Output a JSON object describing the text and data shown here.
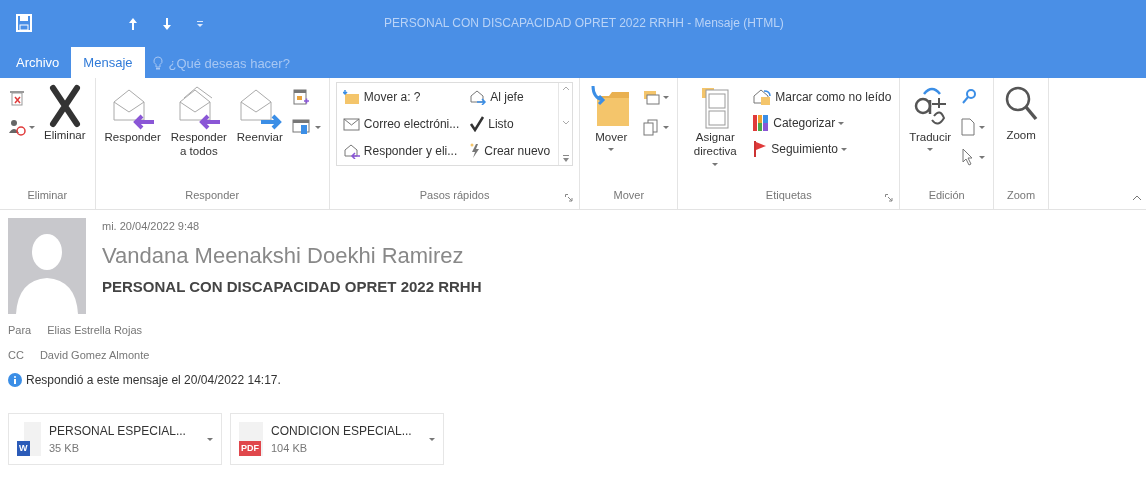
{
  "window": {
    "title": "PERSONAL CON DISCAPACIDAD OPRET 2022 RRHH - Mensaje (HTML)"
  },
  "tabs": [
    {
      "label": "Archivo",
      "selected": false
    },
    {
      "label": "Mensaje",
      "selected": true
    }
  ],
  "tell_me": {
    "placeholder": "¿Qué deseas hacer?"
  },
  "ribbon": {
    "groups": [
      {
        "label": "Eliminar",
        "items": [
          {
            "kind": "smallicons",
            "count_carets": [
              false,
              true
            ]
          },
          {
            "kind": "large",
            "label": "Eliminar",
            "caret": false
          }
        ]
      },
      {
        "label": "Responder",
        "items": [
          {
            "kind": "large",
            "label": "Responder",
            "caret": false
          },
          {
            "kind": "large",
            "label": "Responder a todos",
            "caret": false
          },
          {
            "kind": "large",
            "label": "Reenviar",
            "caret": false
          },
          {
            "kind": "smallicons",
            "count_carets": [
              false,
              true
            ]
          }
        ]
      },
      {
        "label": "Pasos rápidos",
        "launcher": true,
        "quick_steps": [
          {
            "label": "Mover a: ?"
          },
          {
            "label": "Correo electróni..."
          },
          {
            "label": "Responder y eli..."
          },
          {
            "label": "Al jefe"
          },
          {
            "label": "Listo"
          },
          {
            "label": "Crear nuevo"
          }
        ]
      },
      {
        "label": "Mover",
        "items": [
          {
            "kind": "large",
            "label": "Mover",
            "caret": true
          },
          {
            "kind": "smallicons",
            "count_carets": [
              true,
              true
            ]
          }
        ]
      },
      {
        "label": "Etiquetas",
        "launcher": true,
        "items": [
          {
            "kind": "large",
            "label": "Asignar directiva",
            "caret": true
          },
          {
            "kind": "smalllist",
            "entries": [
              {
                "label": "Marcar como no leído",
                "caret": false
              },
              {
                "label": "Categorizar",
                "caret": true
              },
              {
                "label": "Seguimiento",
                "caret": true
              }
            ]
          }
        ]
      },
      {
        "label": "Edición",
        "items": [
          {
            "kind": "large",
            "label": "Traducir",
            "caret": true
          },
          {
            "kind": "smallicons",
            "count_carets": [
              false,
              true,
              true
            ]
          }
        ]
      },
      {
        "label": "Zoom",
        "items": [
          {
            "kind": "large",
            "label": "Zoom",
            "caret": false
          }
        ]
      }
    ]
  },
  "message": {
    "date": "mi. 20/04/2022 9:48",
    "sender": "Vandana Meenakshi Doekhi Ramirez",
    "subject": "PERSONAL CON DISCAPACIDAD OPRET 2022 RRHH",
    "recipients": [
      {
        "label": "Para",
        "value": "Elias Estrella Rojas"
      },
      {
        "label": "CC",
        "value": "David Gomez Almonte"
      }
    ],
    "info": "Respondió a este mensaje el 20/04/2022 14:17.",
    "attachments": [
      {
        "kind": "word",
        "badge": "W",
        "name": "PERSONAL ESPECIAL...",
        "size": "35 KB"
      },
      {
        "kind": "pdf",
        "badge": "PDF",
        "name": "CONDICION ESPECIAL...",
        "size": "104 KB"
      }
    ]
  }
}
